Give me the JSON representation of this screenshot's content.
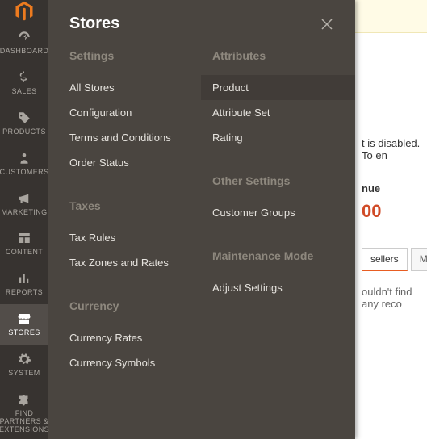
{
  "rail": {
    "items": [
      {
        "name": "dashboard",
        "label": "DASHBOARD"
      },
      {
        "name": "sales",
        "label": "SALES"
      },
      {
        "name": "products",
        "label": "PRODUCTS"
      },
      {
        "name": "customers",
        "label": "CUSTOMERS"
      },
      {
        "name": "marketing",
        "label": "MARKETING"
      },
      {
        "name": "content",
        "label": "CONTENT"
      },
      {
        "name": "reports",
        "label": "REPORTS"
      },
      {
        "name": "stores",
        "label": "STORES"
      },
      {
        "name": "system",
        "label": "SYSTEM"
      },
      {
        "name": "partners",
        "label": "FIND PARTNERS & EXTENSIONS"
      }
    ]
  },
  "flyout": {
    "title": "Stores",
    "left": [
      {
        "title": "Settings",
        "items": [
          "All Stores",
          "Configuration",
          "Terms and Conditions",
          "Order Status"
        ]
      },
      {
        "title": "Taxes",
        "items": [
          "Tax Rules",
          "Tax Zones and Rates"
        ]
      },
      {
        "title": "Currency",
        "items": [
          "Currency Rates",
          "Currency Symbols"
        ]
      }
    ],
    "right": [
      {
        "title": "Attributes",
        "items": [
          "Product",
          "Attribute Set",
          "Rating"
        ]
      },
      {
        "title": "Other Settings",
        "items": [
          "Customer Groups"
        ]
      },
      {
        "title": "Maintenance Mode",
        "items": [
          "Adjust Settings"
        ]
      }
    ]
  },
  "bg": {
    "disabled_fragment": "t is disabled. To en",
    "label_fragment": "nue",
    "value": "00",
    "tab_sellers": "sellers",
    "tab_most": "Most",
    "empty_fragment": "ouldn't find any reco"
  }
}
